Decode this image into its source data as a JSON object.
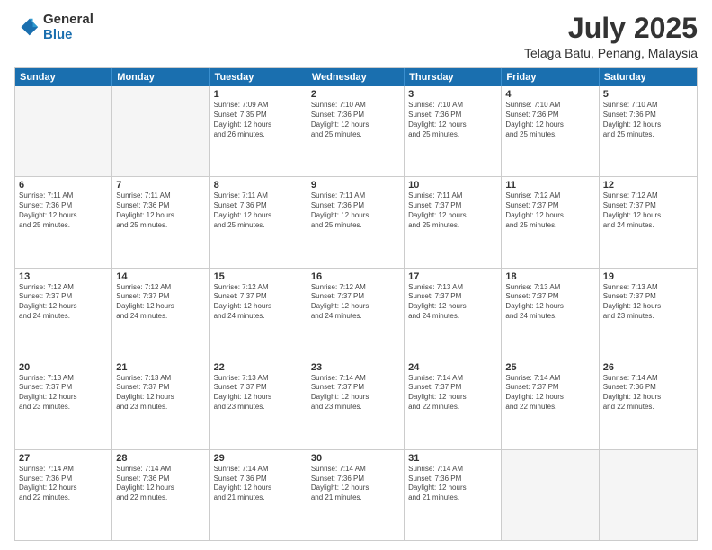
{
  "logo": {
    "general": "General",
    "blue": "Blue"
  },
  "header": {
    "month": "July 2025",
    "location": "Telaga Batu, Penang, Malaysia"
  },
  "weekdays": [
    "Sunday",
    "Monday",
    "Tuesday",
    "Wednesday",
    "Thursday",
    "Friday",
    "Saturday"
  ],
  "rows": [
    [
      {
        "day": "",
        "info": ""
      },
      {
        "day": "",
        "info": ""
      },
      {
        "day": "1",
        "info": "Sunrise: 7:09 AM\nSunset: 7:35 PM\nDaylight: 12 hours\nand 26 minutes."
      },
      {
        "day": "2",
        "info": "Sunrise: 7:10 AM\nSunset: 7:36 PM\nDaylight: 12 hours\nand 25 minutes."
      },
      {
        "day": "3",
        "info": "Sunrise: 7:10 AM\nSunset: 7:36 PM\nDaylight: 12 hours\nand 25 minutes."
      },
      {
        "day": "4",
        "info": "Sunrise: 7:10 AM\nSunset: 7:36 PM\nDaylight: 12 hours\nand 25 minutes."
      },
      {
        "day": "5",
        "info": "Sunrise: 7:10 AM\nSunset: 7:36 PM\nDaylight: 12 hours\nand 25 minutes."
      }
    ],
    [
      {
        "day": "6",
        "info": "Sunrise: 7:11 AM\nSunset: 7:36 PM\nDaylight: 12 hours\nand 25 minutes."
      },
      {
        "day": "7",
        "info": "Sunrise: 7:11 AM\nSunset: 7:36 PM\nDaylight: 12 hours\nand 25 minutes."
      },
      {
        "day": "8",
        "info": "Sunrise: 7:11 AM\nSunset: 7:36 PM\nDaylight: 12 hours\nand 25 minutes."
      },
      {
        "day": "9",
        "info": "Sunrise: 7:11 AM\nSunset: 7:36 PM\nDaylight: 12 hours\nand 25 minutes."
      },
      {
        "day": "10",
        "info": "Sunrise: 7:11 AM\nSunset: 7:37 PM\nDaylight: 12 hours\nand 25 minutes."
      },
      {
        "day": "11",
        "info": "Sunrise: 7:12 AM\nSunset: 7:37 PM\nDaylight: 12 hours\nand 25 minutes."
      },
      {
        "day": "12",
        "info": "Sunrise: 7:12 AM\nSunset: 7:37 PM\nDaylight: 12 hours\nand 24 minutes."
      }
    ],
    [
      {
        "day": "13",
        "info": "Sunrise: 7:12 AM\nSunset: 7:37 PM\nDaylight: 12 hours\nand 24 minutes."
      },
      {
        "day": "14",
        "info": "Sunrise: 7:12 AM\nSunset: 7:37 PM\nDaylight: 12 hours\nand 24 minutes."
      },
      {
        "day": "15",
        "info": "Sunrise: 7:12 AM\nSunset: 7:37 PM\nDaylight: 12 hours\nand 24 minutes."
      },
      {
        "day": "16",
        "info": "Sunrise: 7:12 AM\nSunset: 7:37 PM\nDaylight: 12 hours\nand 24 minutes."
      },
      {
        "day": "17",
        "info": "Sunrise: 7:13 AM\nSunset: 7:37 PM\nDaylight: 12 hours\nand 24 minutes."
      },
      {
        "day": "18",
        "info": "Sunrise: 7:13 AM\nSunset: 7:37 PM\nDaylight: 12 hours\nand 24 minutes."
      },
      {
        "day": "19",
        "info": "Sunrise: 7:13 AM\nSunset: 7:37 PM\nDaylight: 12 hours\nand 23 minutes."
      }
    ],
    [
      {
        "day": "20",
        "info": "Sunrise: 7:13 AM\nSunset: 7:37 PM\nDaylight: 12 hours\nand 23 minutes."
      },
      {
        "day": "21",
        "info": "Sunrise: 7:13 AM\nSunset: 7:37 PM\nDaylight: 12 hours\nand 23 minutes."
      },
      {
        "day": "22",
        "info": "Sunrise: 7:13 AM\nSunset: 7:37 PM\nDaylight: 12 hours\nand 23 minutes."
      },
      {
        "day": "23",
        "info": "Sunrise: 7:14 AM\nSunset: 7:37 PM\nDaylight: 12 hours\nand 23 minutes."
      },
      {
        "day": "24",
        "info": "Sunrise: 7:14 AM\nSunset: 7:37 PM\nDaylight: 12 hours\nand 22 minutes."
      },
      {
        "day": "25",
        "info": "Sunrise: 7:14 AM\nSunset: 7:37 PM\nDaylight: 12 hours\nand 22 minutes."
      },
      {
        "day": "26",
        "info": "Sunrise: 7:14 AM\nSunset: 7:36 PM\nDaylight: 12 hours\nand 22 minutes."
      }
    ],
    [
      {
        "day": "27",
        "info": "Sunrise: 7:14 AM\nSunset: 7:36 PM\nDaylight: 12 hours\nand 22 minutes."
      },
      {
        "day": "28",
        "info": "Sunrise: 7:14 AM\nSunset: 7:36 PM\nDaylight: 12 hours\nand 22 minutes."
      },
      {
        "day": "29",
        "info": "Sunrise: 7:14 AM\nSunset: 7:36 PM\nDaylight: 12 hours\nand 21 minutes."
      },
      {
        "day": "30",
        "info": "Sunrise: 7:14 AM\nSunset: 7:36 PM\nDaylight: 12 hours\nand 21 minutes."
      },
      {
        "day": "31",
        "info": "Sunrise: 7:14 AM\nSunset: 7:36 PM\nDaylight: 12 hours\nand 21 minutes."
      },
      {
        "day": "",
        "info": ""
      },
      {
        "day": "",
        "info": ""
      }
    ]
  ]
}
